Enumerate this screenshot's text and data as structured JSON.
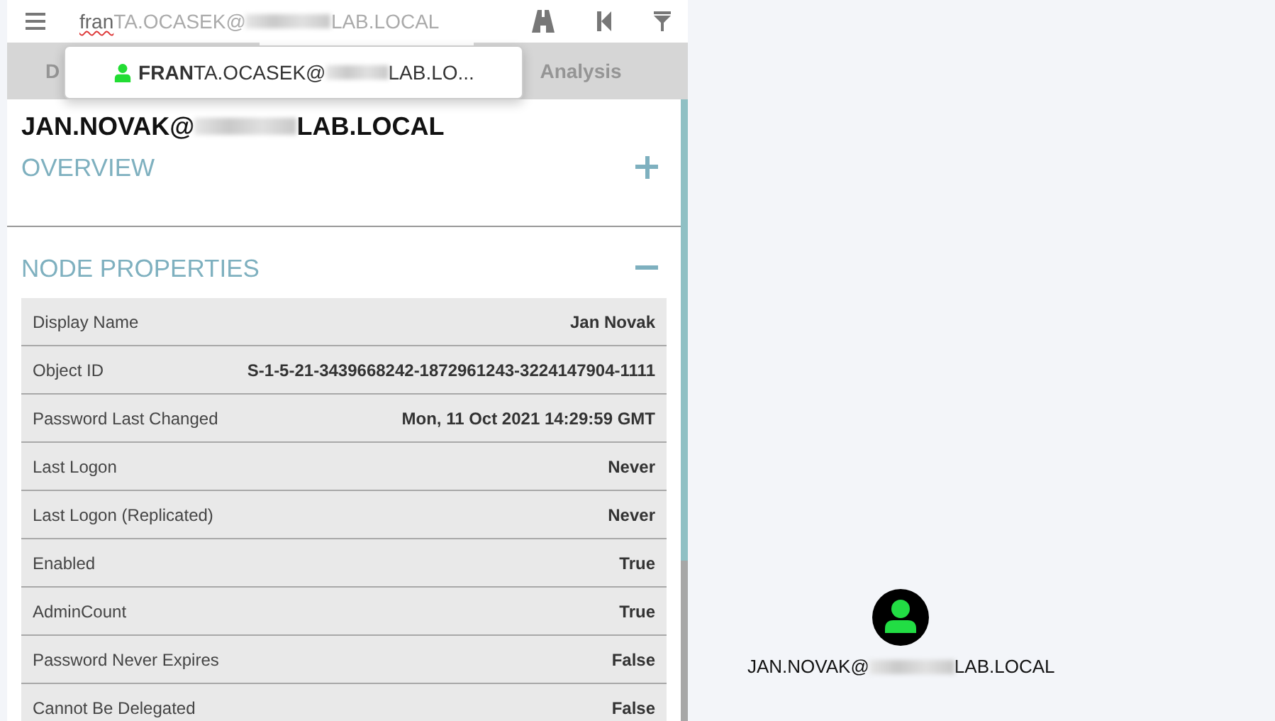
{
  "search": {
    "typed": "fran",
    "completion_prefix": "TA.OCASEK@",
    "completion_suffix": "LAB.LOCAL"
  },
  "suggestions": [
    {
      "prefix": "**FRAN**TA.OCASEK@",
      "suffix": "LAB.LO..."
    }
  ],
  "tabs": [
    {
      "label": "D",
      "selected": false
    },
    {
      "selected": true
    },
    {
      "label": "Analysis",
      "selected": false
    }
  ],
  "node": {
    "name_prefix": "JAN.NOVAK@",
    "name_suffix": "LAB.LOCAL"
  },
  "sections": [
    {
      "title": "OVERVIEW",
      "expanded": false
    },
    {
      "title": "NODE PROPERTIES",
      "expanded": true,
      "properties": [
        {
          "label": "Display Name",
          "value": "Jan Novak"
        },
        {
          "label": "Object ID",
          "value": "S-1-5-21-3439668242-1872961243-3224147904-1111"
        },
        {
          "label": "Password Last Changed",
          "value": "Mon, 11 Oct 2021 14:29:59 GMT"
        },
        {
          "label": "Last Logon",
          "value": "Never"
        },
        {
          "label": "Last Logon (Replicated)",
          "value": "Never"
        },
        {
          "label": "Enabled",
          "value": "True"
        },
        {
          "label": "AdminCount",
          "value": "True"
        },
        {
          "label": "Password Never Expires",
          "value": "False"
        },
        {
          "label": "Cannot Be Delegated",
          "value": "False"
        }
      ]
    }
  ],
  "graph": {
    "nodes": [
      {
        "kind": "user",
        "label_prefix": "JAN.NOVAK@",
        "label_suffix": "LAB.LOCAL"
      }
    ]
  }
}
